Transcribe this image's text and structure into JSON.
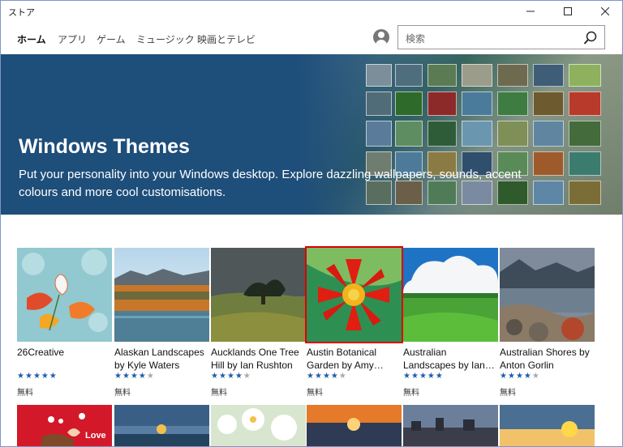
{
  "window": {
    "title": "ストア",
    "controls": [
      "minimize-icon",
      "maximize-icon",
      "close-icon"
    ]
  },
  "nav": {
    "tabs": [
      {
        "label": "ホーム",
        "active": true
      },
      {
        "label": "アプリ",
        "active": false
      },
      {
        "label": "ゲーム",
        "active": false
      },
      {
        "label": "ミュージック",
        "active": false
      },
      {
        "label": "映画とテレビ",
        "active": false
      }
    ],
    "search_placeholder": "検索",
    "user_icon": "user-icon",
    "search_icon": "search-icon"
  },
  "hero": {
    "title": "Windows Themes",
    "subtitle": "Put your personality into your Windows desktop. Explore dazzling wallpapers, sounds, accent colours and more cool customisations."
  },
  "themes": [
    {
      "title": "26Creative",
      "rating": 4.5,
      "price": "無料",
      "selected": false
    },
    {
      "title": "Alaskan Landscapes by Kyle Waters",
      "rating": 4,
      "price": "無料",
      "selected": false
    },
    {
      "title": "Aucklands One Tree Hill by Ian Rushton",
      "rating": 4,
      "price": "無料",
      "selected": false
    },
    {
      "title": "Austin Botanical Garden by Amy…",
      "rating": 4,
      "price": "無料",
      "selected": true
    },
    {
      "title": "Australian Landscapes by Ian…",
      "rating": 4.5,
      "price": "無料",
      "selected": false
    },
    {
      "title": "Australian Shores by Anton Gorlin",
      "rating": 4,
      "price": "無料",
      "selected": false
    }
  ],
  "second_row": [
    {
      "love_text": "Love"
    },
    {},
    {},
    {},
    {},
    {}
  ],
  "colors": {
    "accent": "#1e4e7a",
    "star": "#1f5ea8",
    "selected_outline": "#dd0000"
  }
}
